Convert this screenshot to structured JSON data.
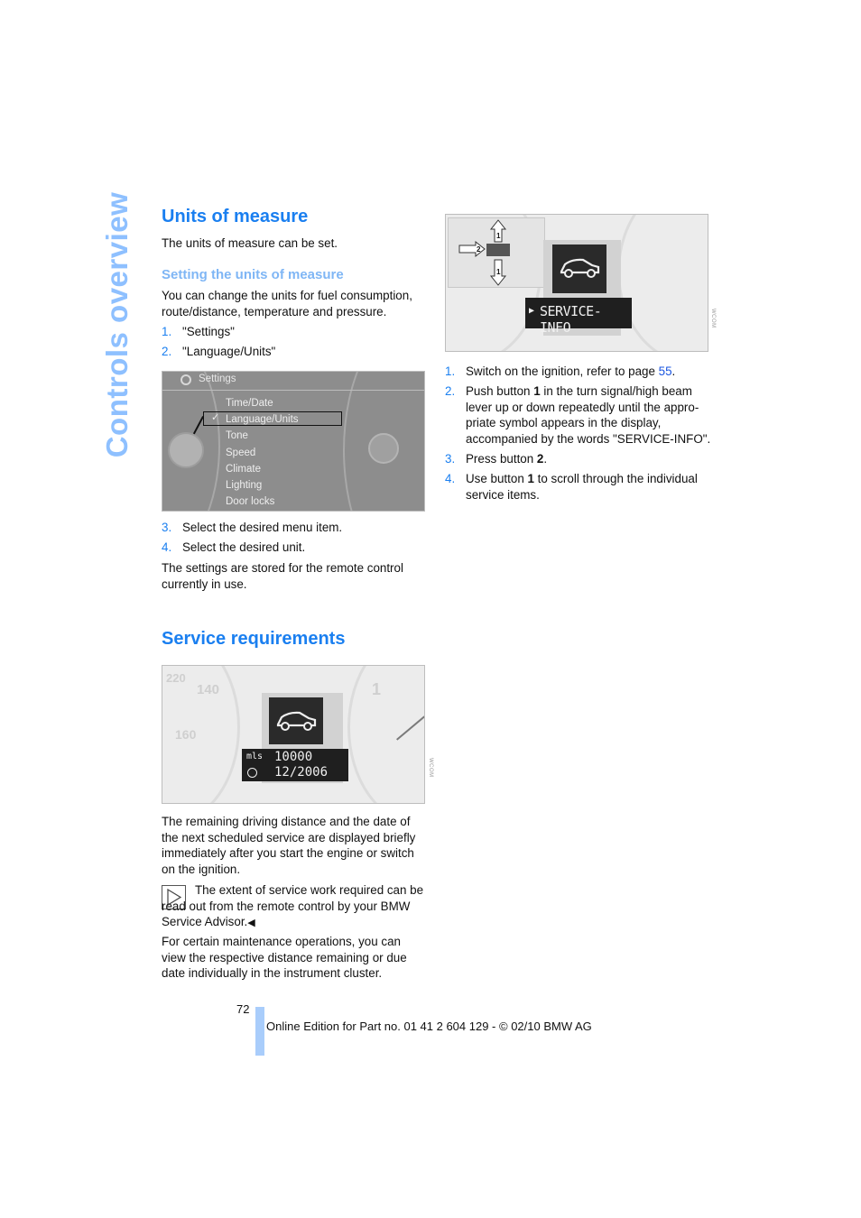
{
  "side_title": "Controls overview",
  "section1": {
    "heading": "Units of measure",
    "intro": "The units of measure can be set.",
    "subheading": "Setting the units of measure",
    "body": "You can change the units for fuel consumption, route/distance, temperature and pressure.",
    "steps_a": [
      {
        "num": "1.",
        "text": "\"Settings\""
      },
      {
        "num": "2.",
        "text": "\"Language/Units\""
      }
    ],
    "figure": {
      "title": "Settings",
      "menu_items": [
        "Time/Date",
        "Language/Units",
        "Tone",
        "Speed",
        "Climate",
        "Lighting",
        "Door locks"
      ],
      "selected_item": "Language/Units"
    },
    "steps_b": [
      {
        "num": "3.",
        "text": "Select the desired menu item."
      },
      {
        "num": "4.",
        "text": "Select the desired unit."
      }
    ],
    "outro": "The settings are stored for the remote control currently in use."
  },
  "section2": {
    "heading": "Service requirements",
    "figure": {
      "units_label": "mls",
      "distance": "10000",
      "date": "12/2006",
      "gauge_labels": [
        "220",
        "140",
        "160",
        "1"
      ]
    },
    "para1": "The remaining driving distance and the date of the next scheduled service are displayed briefly immediately after you start the engine or switch on the ignition.",
    "note": "The extent of service work required can be read out from the remote control by your BMW Service Advisor.",
    "note_end": "◀",
    "para2": "For certain maintenance operations, you can view the respective distance remaining or due date individually in the instrument cluster."
  },
  "right_column": {
    "figure": {
      "display_text": "SERVICE-INFO",
      "button_labels": [
        "1",
        "2",
        "1"
      ]
    },
    "steps": [
      {
        "num": "1.",
        "pre": "Switch on the ignition, refer to page ",
        "link": "55",
        "post": "."
      },
      {
        "num": "2.",
        "pre": "Push button ",
        "bold": "1",
        "post": " in the turn signal/high beam lever up or down repeatedly until the appro­priate symbol appears in the display, accompanied by the words \"SERVICE-INFO\"."
      },
      {
        "num": "3.",
        "pre": "Press button ",
        "bold": "2",
        "post": "."
      },
      {
        "num": "4.",
        "pre": "Use button ",
        "bold": "1",
        "post": " to scroll through the individual service items."
      }
    ]
  },
  "footer": {
    "page_number": "72",
    "edition": "Online Edition for Part no. 01 41 2 604 129 - © 02/10 BMW AG"
  },
  "colors": {
    "heading_blue": "#1a7ff0",
    "subheading_blue": "#7fb6f5",
    "side_title_blue": "#8ec0ff",
    "link_blue": "#1a55e0",
    "footer_bar": "#a9cdfb"
  }
}
